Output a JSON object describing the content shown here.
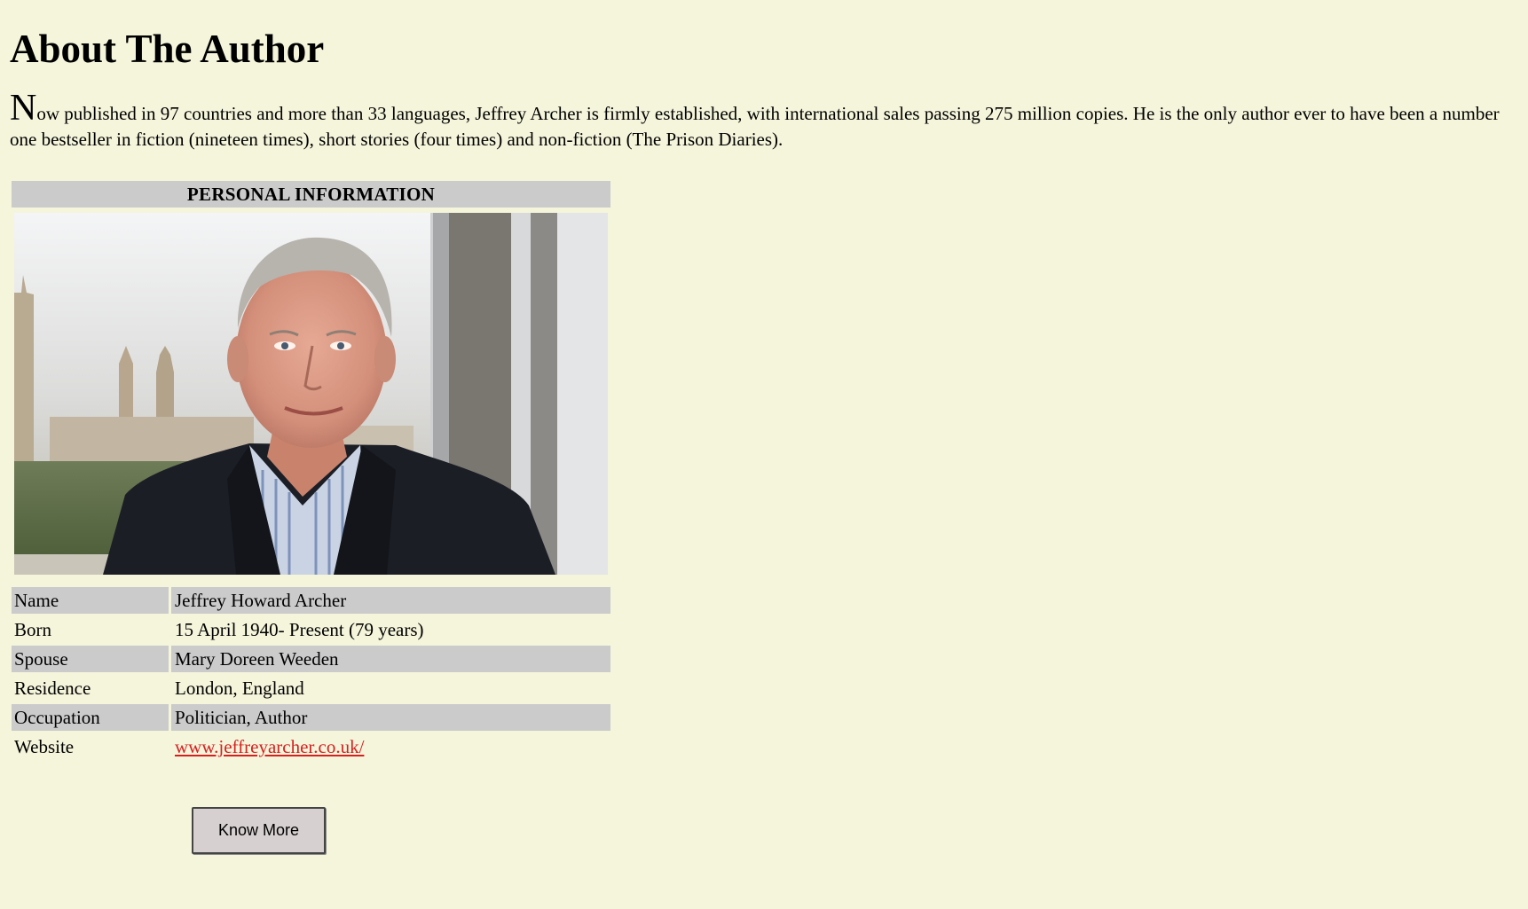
{
  "page": {
    "title": "About The Author",
    "intro_dropcap": "N",
    "intro_rest": "ow published in 97 countries and more than 33 languages, Jeffrey Archer is firmly established, with international sales passing 275 million copies. He is the only author ever to have been a number one bestseller in fiction (nineteen times), short stories (four times) and non-fiction (The Prison Diaries)."
  },
  "info": {
    "header": "PERSONAL INFORMATION",
    "rows": [
      {
        "label": "Name",
        "value": "Jeffrey Howard Archer"
      },
      {
        "label": "Born",
        "value": "15 April 1940- Present (79 years)"
      },
      {
        "label": "Spouse",
        "value": "Mary Doreen Weeden"
      },
      {
        "label": "Residence",
        "value": "London, England"
      },
      {
        "label": "Occupation",
        "value": "Politician, Author"
      },
      {
        "label": "Website",
        "value": "www.jeffreyarcher.co.uk/"
      }
    ]
  },
  "actions": {
    "know_more_label": "Know More"
  },
  "colors": {
    "background": "#f5f5dc",
    "row_shade": "#cbcbcb",
    "link": "#d62020"
  }
}
